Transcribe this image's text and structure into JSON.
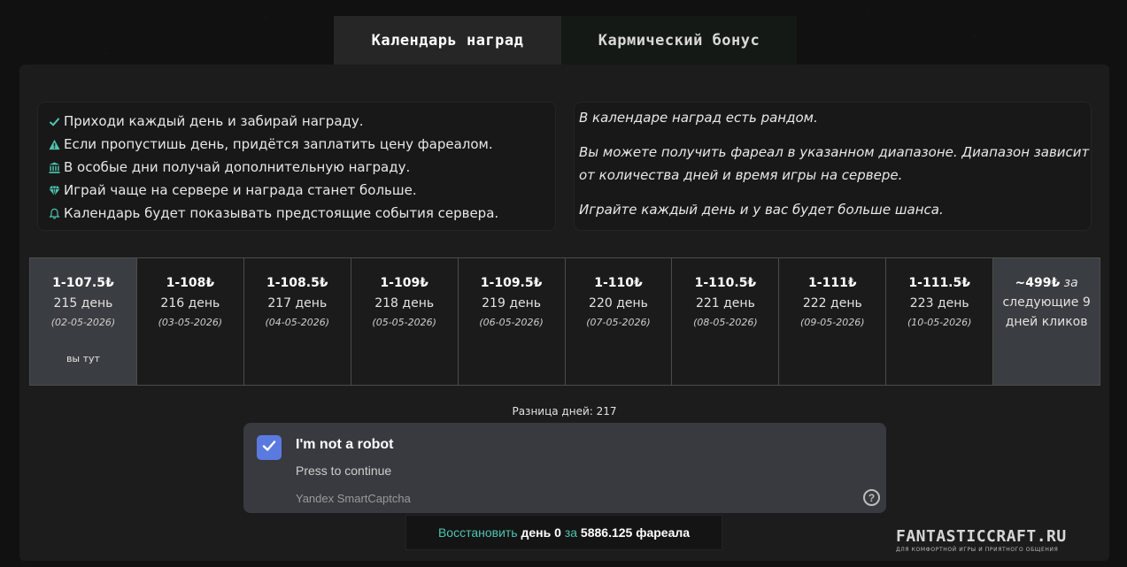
{
  "tabs": [
    {
      "label": "Календарь наград",
      "active": true
    },
    {
      "label": "Кармический бонус",
      "active": false
    }
  ],
  "rules": [
    {
      "icon": "check-icon",
      "text": "Приходи каждый день и забирай награду."
    },
    {
      "icon": "warning-icon",
      "text": "Если пропустишь день, придётся заплатить цену фареалом."
    },
    {
      "icon": "bank-icon",
      "text": "В особые дни получай дополнительную награду."
    },
    {
      "icon": "diamond-icon",
      "text": "Играй чаще на сервере и награда станет больше."
    },
    {
      "icon": "bell-icon",
      "text": "Календарь будет показывать предстоящие события сервера."
    }
  ],
  "random_info": [
    "В календаре наград есть рандом.",
    "Вы можете получить фареал в указанном диапазоне. Диапазон зависит от количества дней и время игры на сервере.",
    "Играйте каждый день и у вас будет больше шанса."
  ],
  "calendar": {
    "days": [
      {
        "amount": "1-107.5₺",
        "day": "215 день",
        "date": "(02-05-2026)",
        "current_label": "вы тут"
      },
      {
        "amount": "1-108₺",
        "day": "216 день",
        "date": "(03-05-2026)"
      },
      {
        "amount": "1-108.5₺",
        "day": "217 день",
        "date": "(04-05-2026)"
      },
      {
        "amount": "1-109₺",
        "day": "218 день",
        "date": "(05-05-2026)"
      },
      {
        "amount": "1-109.5₺",
        "day": "219 день",
        "date": "(06-05-2026)"
      },
      {
        "amount": "1-110₺",
        "day": "220 день",
        "date": "(07-05-2026)"
      },
      {
        "amount": "1-110.5₺",
        "day": "221 день",
        "date": "(08-05-2026)"
      },
      {
        "amount": "1-111₺",
        "day": "222 день",
        "date": "(09-05-2026)"
      },
      {
        "amount": "1-111.5₺",
        "day": "223 день",
        "date": "(10-05-2026)"
      }
    ],
    "future": {
      "amount": "~499₺",
      "za": "за",
      "text": "следующие 9 дней кликов"
    }
  },
  "diff_label": "Разница дней: 217",
  "captcha": {
    "title": "I'm not a robot",
    "subtitle": "Press to continue",
    "brand": "Yandex SmartCaptcha",
    "help": "?",
    "checked": true
  },
  "restore": {
    "action": "Восстановить",
    "day": "день 0",
    "za": "за",
    "cost": "5886.125 фареала"
  },
  "watermark": {
    "name": "FANTASTICCRAFT.RU",
    "tagline": "ДЛЯ КОМФОРТНОЙ ИГРЫ И ПРИЯТНОГО ОБЩЕНИЯ"
  },
  "colors": {
    "accent": "#4fc3b0",
    "checkbox": "#5b7ae0",
    "current_day_bg": "#3a3d41"
  }
}
